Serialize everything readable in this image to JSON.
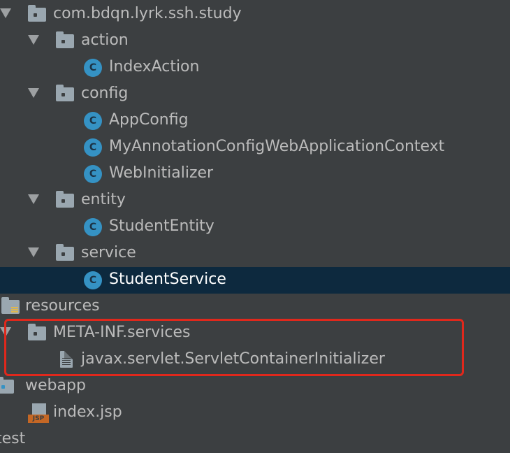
{
  "tree": {
    "pkg": "com.bdqn.lyrk.ssh.study",
    "action": "action",
    "index_action": "IndexAction",
    "config": "config",
    "app_config": "AppConfig",
    "my_annotation": "MyAnnotationConfigWebApplicationContext",
    "web_initializer": "WebInitializer",
    "entity": "entity",
    "student_entity": "StudentEntity",
    "service": "service",
    "student_service": "StudentService",
    "resources": "resources",
    "meta_inf": "META-INF.services",
    "servlet_initializer": "javax.servlet.ServletContainerInitializer",
    "webapp": "webapp",
    "index_jsp": "index.jsp",
    "test": "test"
  },
  "icons": {
    "class_letter": "C",
    "jsp_badge": "JSP"
  },
  "colors": {
    "background": "#3c3f41",
    "selection": "#0d293e",
    "class_icon": "#3592c4",
    "highlight_box": "#e0281c"
  }
}
